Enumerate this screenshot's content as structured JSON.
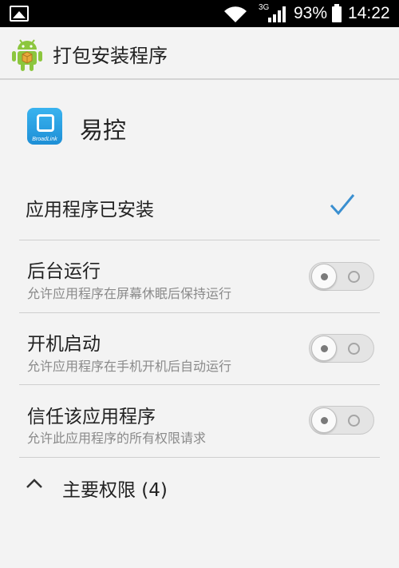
{
  "status_bar": {
    "network": "3G",
    "battery_percent": "93%",
    "time": "14:22",
    "icons": [
      "image-icon",
      "wifi-icon",
      "signal-icon",
      "battery-icon"
    ]
  },
  "action_bar": {
    "title": "打包安装程序",
    "icon": "android-icon"
  },
  "app": {
    "name": "易控",
    "icon_brand": "BroadLink"
  },
  "install_status": {
    "label": "应用程序已安装",
    "icon": "check-icon"
  },
  "settings": [
    {
      "title": "后台运行",
      "subtitle": "允许应用程序在屏幕休眠后保持运行",
      "enabled": false
    },
    {
      "title": "开机启动",
      "subtitle": "允许应用程序在手机开机后自动运行",
      "enabled": false
    },
    {
      "title": "信任该应用程序",
      "subtitle": "允许此应用程序的所有权限请求",
      "enabled": false
    }
  ],
  "permissions": {
    "label": "主要权限 (4)",
    "icon": "chevron-up-icon"
  },
  "colors": {
    "accent": "#3a8fd0",
    "background": "#f3f3f3",
    "status_bar": "#000000",
    "android_green": "#8cc63e"
  }
}
